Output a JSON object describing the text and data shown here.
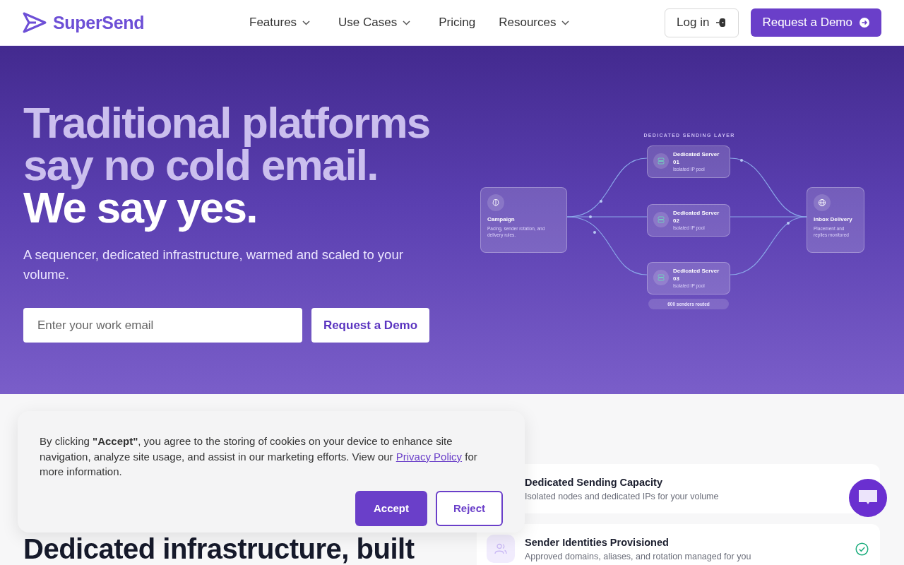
{
  "header": {
    "logo": "SuperSend",
    "nav": [
      {
        "label": "Features",
        "has_menu": true
      },
      {
        "label": "Use Cases",
        "has_menu": true
      },
      {
        "label": "Pricing",
        "has_menu": false
      },
      {
        "label": "Resources",
        "has_menu": true
      }
    ],
    "login": "Log in",
    "demo": "Request a Demo"
  },
  "hero": {
    "headline": [
      {
        "text": "Traditional platforms",
        "kind": "muted"
      },
      {
        "text": "say no cold email.",
        "kind": "muted"
      },
      {
        "text": "We say yes.",
        "kind": "emphasis"
      }
    ],
    "subtitle": "A sequencer, dedicated infrastructure, warmed and scaled to your volume.",
    "email": {
      "placeholder": "Enter your work email"
    },
    "button": "Request a Demo"
  },
  "diagram": {
    "label": "DEDICATED SENDING LAYER",
    "source": {
      "title": "Campaign",
      "text": "Pacing, sender rotation, and delivery rules."
    },
    "servers": [
      {
        "title": "Dedicated Server 01",
        "text": "Isolated IP pool"
      },
      {
        "title": "Dedicated Server 02",
        "text": "Isolated IP pool"
      },
      {
        "title": "Dedicated Server 03",
        "text": "Isolated IP pool"
      }
    ],
    "footer": "600 senders routed",
    "destination": {
      "title": "Inbox Delivery",
      "text": "Placement and replies monitored"
    }
  },
  "section": {
    "heading": "Dedicated infrastructure, built",
    "features": [
      {
        "title": "Dedicated Sending Capacity",
        "text": "Isolated nodes and dedicated IPs for your volume"
      },
      {
        "title": "Sender Identities Provisioned",
        "text": "Approved domains, aliases, and rotation managed for you",
        "checked": true
      }
    ]
  },
  "cookie": {
    "text_before": "By clicking **\"Accept\"**, you agree to the storing of cookies on your device to enhance site navigation, analyze site usage, and assist in our marketing efforts. View our",
    "link": "Privacy Policy",
    "text_after": "for more information.",
    "accept": "Accept",
    "reject": "Reject"
  }
}
